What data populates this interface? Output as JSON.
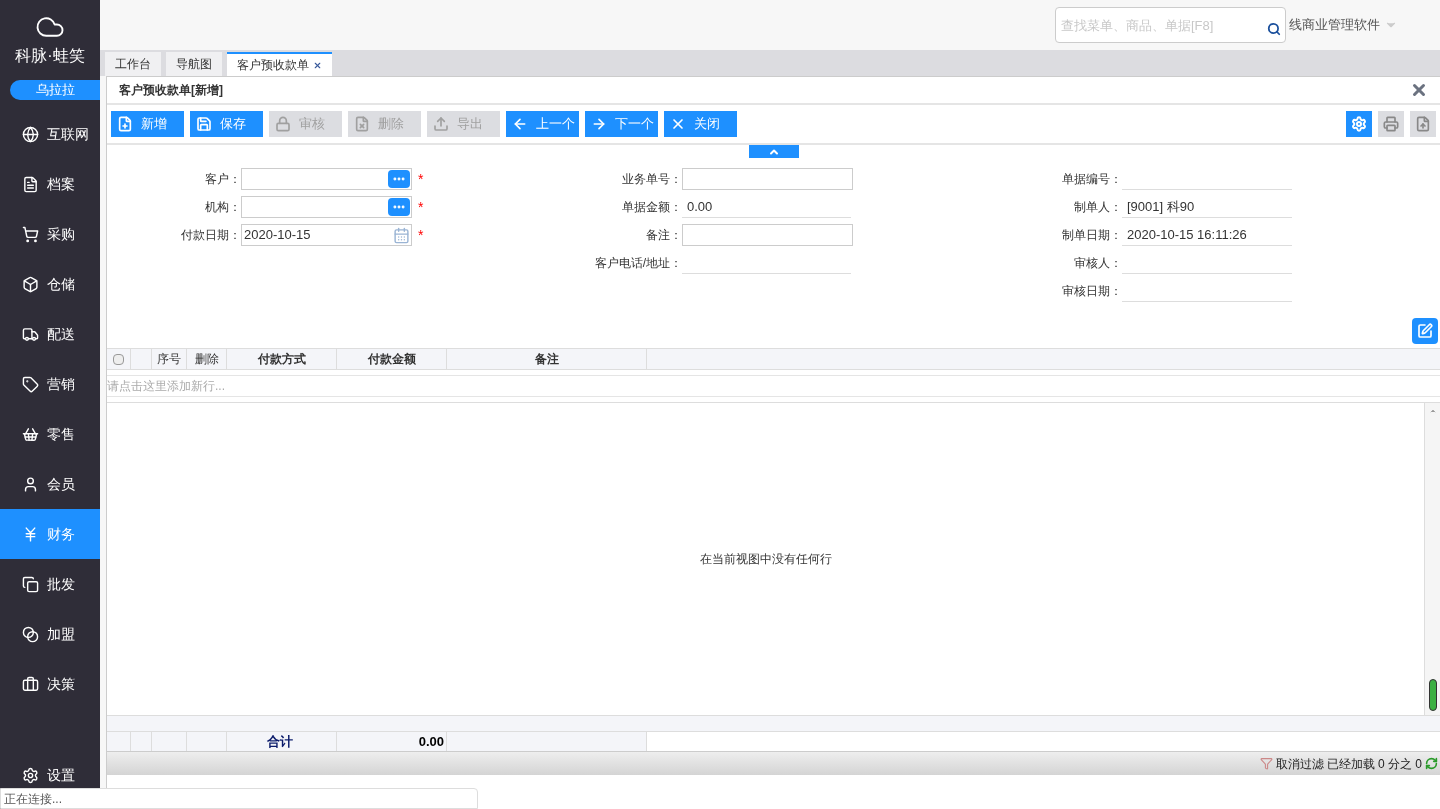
{
  "sidebar": {
    "brand": "科脉·蛙笑",
    "user": "乌拉拉",
    "items": [
      {
        "label": "互联网",
        "selected": false
      },
      {
        "label": "档案",
        "selected": false
      },
      {
        "label": "采购",
        "selected": false
      },
      {
        "label": "仓储",
        "selected": false
      },
      {
        "label": "配送",
        "selected": false
      },
      {
        "label": "营销",
        "selected": false
      },
      {
        "label": "零售",
        "selected": false
      },
      {
        "label": "会员",
        "selected": false
      },
      {
        "label": "财务",
        "selected": true
      },
      {
        "label": "批发",
        "selected": false
      },
      {
        "label": "加盟",
        "selected": false
      },
      {
        "label": "决策",
        "selected": false
      }
    ],
    "settings": "设置"
  },
  "header": {
    "search_placeholder": "查找菜单、商品、单据[F8]",
    "app_name": "线商业管理软件"
  },
  "tabs": [
    {
      "label": "工作台",
      "selected": false,
      "closable": false
    },
    {
      "label": "导航图",
      "selected": false,
      "closable": false
    },
    {
      "label": "客户预收款单",
      "selected": true,
      "closable": true
    }
  ],
  "panel": {
    "title": "客户预收款单[新增]",
    "toolbar": [
      {
        "label": "新增",
        "disabled": false
      },
      {
        "label": "保存",
        "disabled": false
      },
      {
        "label": "审核",
        "disabled": true
      },
      {
        "label": "删除",
        "disabled": true
      },
      {
        "label": "导出",
        "disabled": true
      },
      {
        "label": "上一个",
        "disabled": false
      },
      {
        "label": "下一个",
        "disabled": false
      },
      {
        "label": "关闭",
        "disabled": false
      }
    ],
    "form_left": [
      {
        "label": "客户：",
        "kind": "lookup",
        "required_mark": "*"
      },
      {
        "label": "机构：",
        "kind": "lookup",
        "required_mark": "*"
      },
      {
        "label": "付款日期：",
        "value": "2020-10-15",
        "kind": "date",
        "required_mark": "*"
      }
    ],
    "form_middle": [
      {
        "label": "业务单号：",
        "kind": "input"
      },
      {
        "label": "单据金额：",
        "value": "0.00",
        "kind": "display"
      },
      {
        "label": "备注：",
        "kind": "input"
      },
      {
        "label": "客户电话/地址：",
        "kind": "display"
      }
    ],
    "form_right": [
      {
        "label": "单据编号："
      },
      {
        "label": "制单人：",
        "value": "[9001] 科90"
      },
      {
        "label": "制单日期：",
        "value": "2020-10-15 16:11:26"
      },
      {
        "label": "审核人："
      },
      {
        "label": "审核日期："
      }
    ],
    "grid": {
      "select_all_checked": false,
      "columns": [
        "序号",
        "删除",
        "付款方式",
        "付款金额",
        "备注"
      ],
      "add_row_hint": "请点击这里添加新行...",
      "empty_message": "在当前视图中没有任何行",
      "footer_label": "合计",
      "footer_total": "0.00"
    },
    "status_bar": {
      "cancel_filter": "取消过滤",
      "loaded": "已经加载 0 分之 0"
    }
  },
  "connection_status": "正在连接..."
}
